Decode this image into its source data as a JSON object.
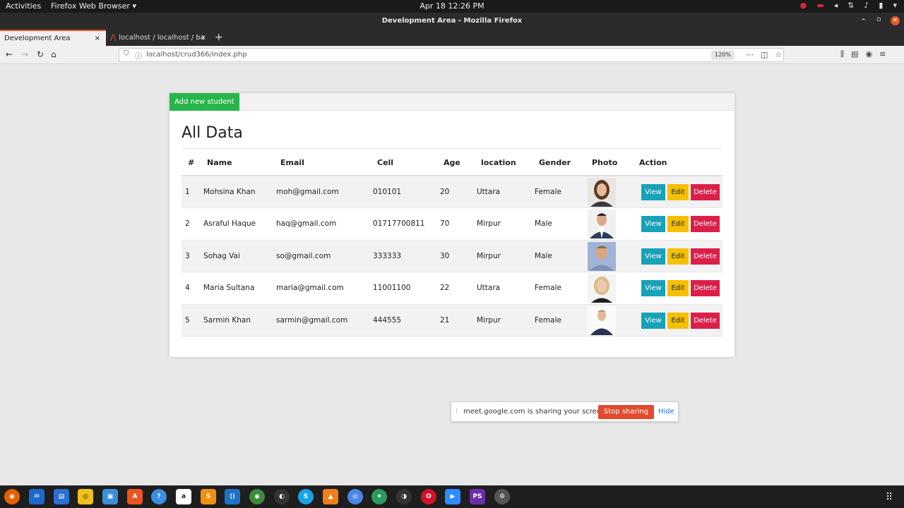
{
  "system": {
    "activities": "Activities",
    "app_menu": "Firefox Web Browser ▾",
    "clock": "Apr 18  12:26 PM"
  },
  "window": {
    "title": "Development Area - Mozilla Firefox"
  },
  "tabs": [
    {
      "label": "Development Area",
      "active": true
    },
    {
      "label": "localhost / localhost / ba",
      "active": false
    }
  ],
  "navbar": {
    "url": "localhost/crud366/index.php",
    "zoom": "120%"
  },
  "page": {
    "add_button": "Add new student",
    "title": "All Data",
    "columns": [
      "#",
      "Name",
      "Email",
      "Cell",
      "Age",
      "location",
      "Gender",
      "Photo",
      "Action"
    ],
    "rows": [
      {
        "num": "1",
        "name": "Mohsina Khan",
        "email": "moh@gmail.com",
        "cell": "010101",
        "age": "20",
        "location": "Uttara",
        "gender": "Female"
      },
      {
        "num": "2",
        "name": "Asraful Haque",
        "email": "haq@gmail.com",
        "cell": "01717700811",
        "age": "70",
        "location": "Mirpur",
        "gender": "Male"
      },
      {
        "num": "3",
        "name": "Sohag Vai",
        "email": "so@gmail.com",
        "cell": "333333",
        "age": "30",
        "location": "Mirpur",
        "gender": "Male"
      },
      {
        "num": "4",
        "name": "Maria Sultana",
        "email": "maria@gmail.com",
        "cell": "11001100",
        "age": "22",
        "location": "Uttara",
        "gender": "Female"
      },
      {
        "num": "5",
        "name": "Sarmin Khan",
        "email": "sarmin@gmail.com",
        "cell": "444555",
        "age": "21",
        "location": "Mirpur",
        "gender": "Female"
      }
    ],
    "actions": {
      "view": "View",
      "edit": "Edit",
      "delete": "Delete"
    }
  },
  "share_notice": {
    "message": "meet.google.com is sharing your screen.",
    "stop": "Stop sharing",
    "hide": "Hide"
  },
  "colors": {
    "add": "#28b54a",
    "view": "#17a2b8",
    "edit": "#f5c001",
    "delete": "#dc1f4a",
    "stop": "#e04a2d"
  }
}
